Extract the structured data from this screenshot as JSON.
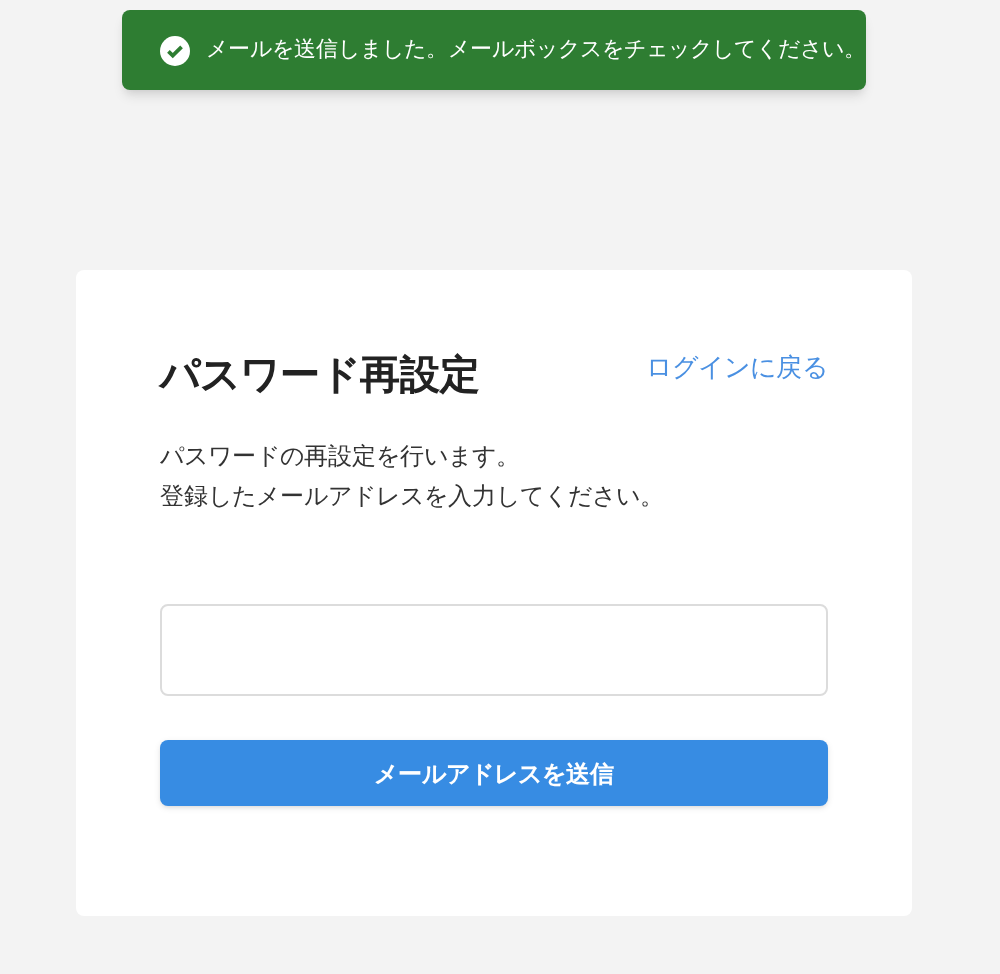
{
  "toast": {
    "message": "メールを送信しました。メールボックスをチェックしてください。"
  },
  "card": {
    "title": "パスワード再設定",
    "back_link": "ログインに戻る",
    "description": [
      "パスワードの再設定を行います。",
      "登録したメールアドレスを入力してください。"
    ],
    "submit_button": "メールアドレスを送信"
  }
}
